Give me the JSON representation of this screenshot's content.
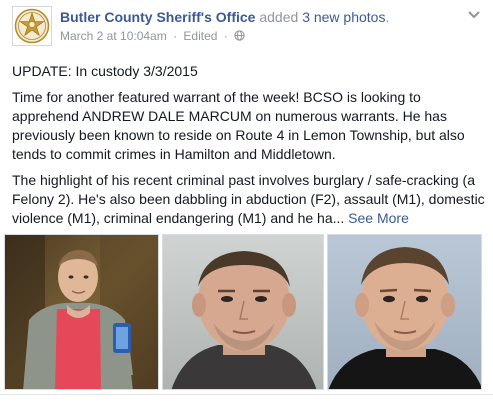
{
  "post": {
    "page_name": "Butler County Sheriff's Office",
    "action_prefix": "added",
    "photo_count_text": "3 new photos",
    "action_suffix": ".",
    "timestamp": "March 2 at 10:04am",
    "edited_label": "Edited",
    "meta_separator": "·",
    "paragraphs": [
      "UPDATE: In custody 3/3/2015",
      "Time for another featured warrant of the week! BCSO is looking to apprehend ANDREW DALE MARCUM on numerous warrants. He has previously been known to reside on Route 4 in Lemon Township, but also tends to commit crimes in Hamilton and Middletown.",
      "The highlight of his recent criminal past involves burglary / safe-cracking (a Felony 2). He's also been dabbling in abduction (F2), assault (M1), domestic violence (M1), criminal endangering (M1) and he ha..."
    ],
    "see_more_label": "See More"
  },
  "icons": {
    "avatar": "sheriff-star-badge-icon",
    "privacy": "globe-icon",
    "options": "chevron-down-icon"
  },
  "colors": {
    "link_blue": "#3b5998",
    "meta_gray": "#90949c",
    "text": "#141823",
    "badge_gold": "#c89b2a"
  }
}
